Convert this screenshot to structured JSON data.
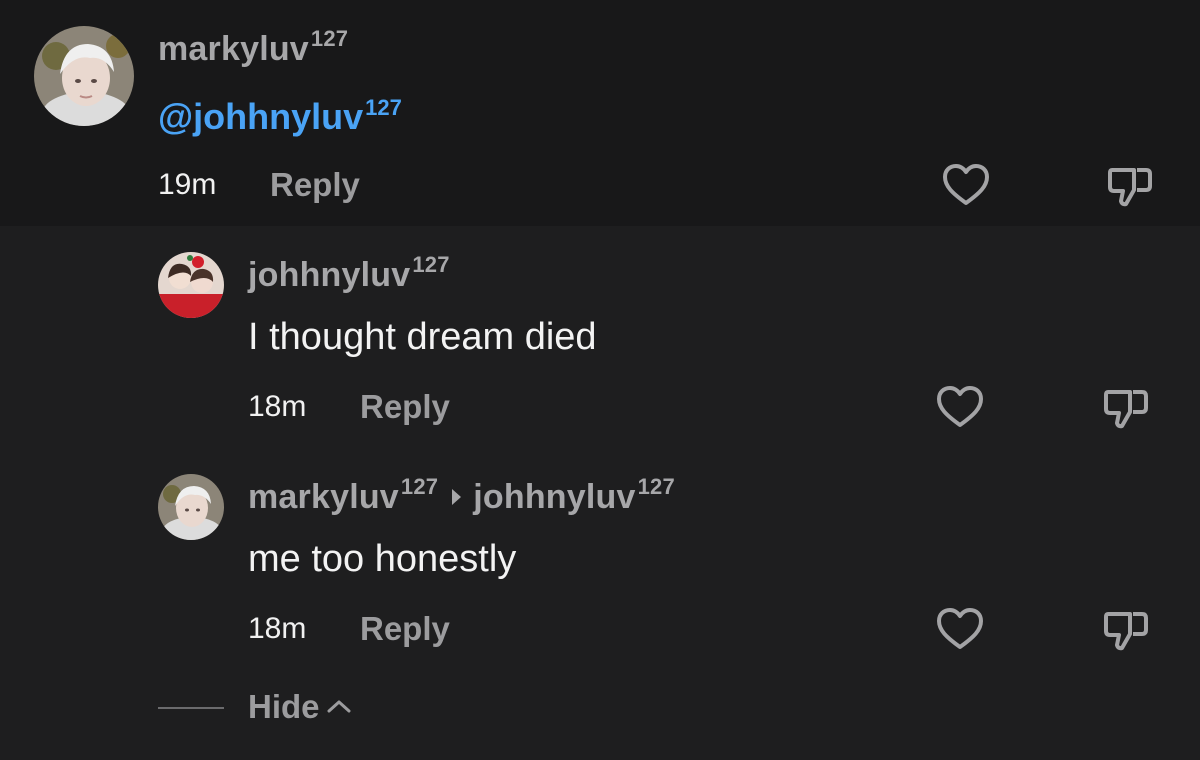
{
  "comments": [
    {
      "username": "markyluv",
      "username_sup": "127",
      "mention": "@johhnyluv",
      "mention_sup": "127",
      "time": "19m",
      "reply_label": "Reply"
    },
    {
      "username": "johhnyluv",
      "username_sup": "127",
      "text": "I thought dream died",
      "time": "18m",
      "reply_label": "Reply"
    },
    {
      "username": "markyluv",
      "username_sup": "127",
      "reply_to": "johhnyluv",
      "reply_to_sup": "127",
      "text": "me too honestly",
      "time": "18m",
      "reply_label": "Reply"
    }
  ],
  "hide_label": "Hide",
  "icons": {
    "like": "heart-icon",
    "dislike": "thumbs-down-icon",
    "reply_arrow": "caret-right-icon",
    "hide_chevron": "chevron-up-icon"
  },
  "colors": {
    "background": "#1e1e1f",
    "top_band": "#181819",
    "mention": "#4aa3f5",
    "muted": "#9c9c9e"
  }
}
